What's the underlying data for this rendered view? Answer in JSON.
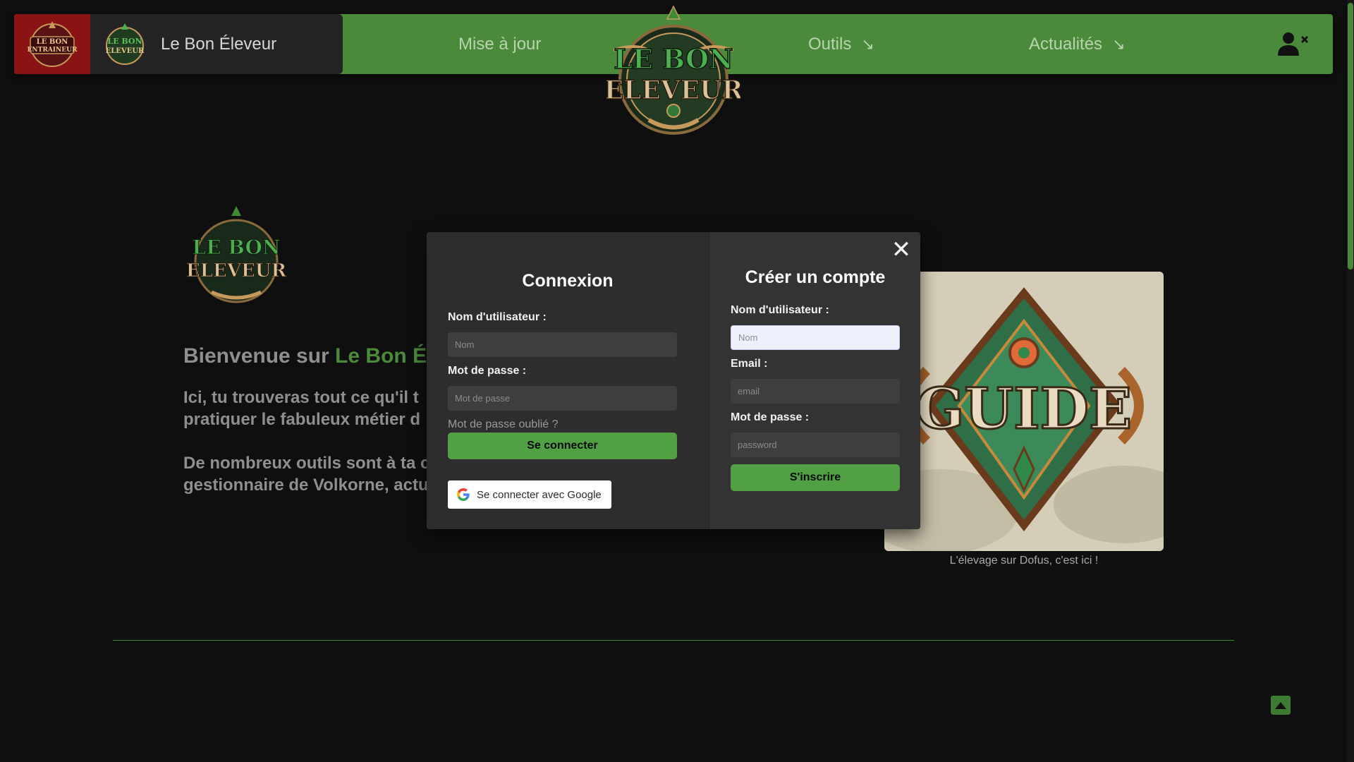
{
  "header": {
    "switch_site_logo_text": "LE BON ENTRAINEUR",
    "brand_logo_text": "LE BON ELEVEUR",
    "brand_title": "Le Bon Éleveur",
    "center_logo_text": "LE BON ELEVEUR",
    "nav": [
      {
        "label": "Mise à jour",
        "arrow": ""
      },
      {
        "label": "Outils",
        "arrow": "↘"
      },
      {
        "label": "Actualités",
        "arrow": "↘"
      }
    ],
    "user_icon": "user-logged-out-icon"
  },
  "hero": {
    "logo_text": "LE BON ELEVEUR",
    "heading_prefix": "Bienvenue sur ",
    "heading_accent": "Le Bon É",
    "para1_line1": "Ici, tu trouveras tout ce qu'il t",
    "para1_line2": "pratiquer le fabuleux métier d",
    "para2_line1": "De nombreux outils sont à ta c",
    "para2_line2": "gestionnaire de Volkorne, actu"
  },
  "guide": {
    "image_text": "GUIDE",
    "caption": "L'élevage sur Dofus, c'est ici !"
  },
  "modal": {
    "close": "✕",
    "login": {
      "title": "Connexion",
      "username_label": "Nom d'utilisateur :",
      "username_placeholder": "Nom",
      "password_label": "Mot de passe :",
      "password_placeholder": "Mot de passe",
      "forgot": "Mot de passe oublié ?",
      "submit": "Se connecter",
      "google": "Se connecter avec Google"
    },
    "register": {
      "title": "Créer un compte",
      "username_label": "Nom d'utilisateur :",
      "username_placeholder": "Nom",
      "email_label": "Email :",
      "email_placeholder": "email",
      "password_label": "Mot de passe :",
      "password_placeholder": "password",
      "submit": "S'inscrire"
    }
  },
  "colors": {
    "brand_green": "#4a8a3a",
    "button_green": "#52a044",
    "switch_red": "#8a1414",
    "background": "#0f0f0f"
  }
}
